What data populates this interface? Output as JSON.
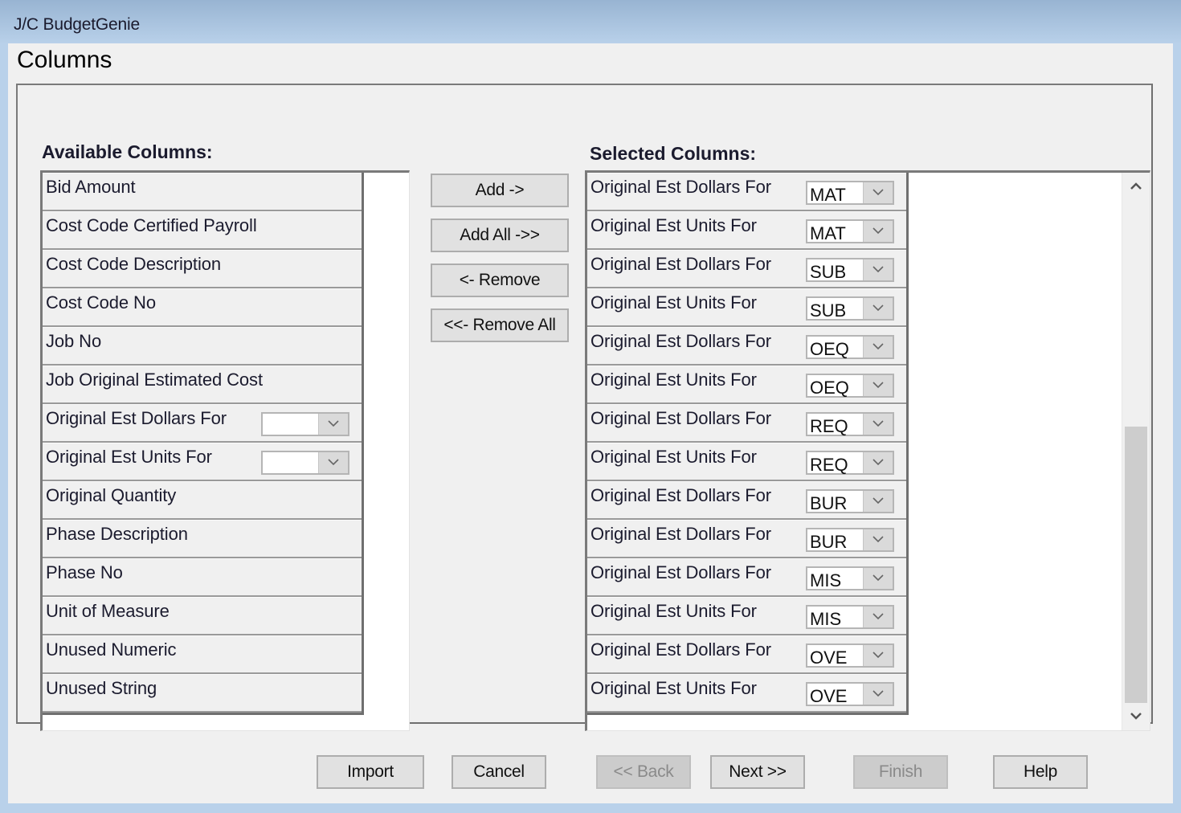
{
  "window": {
    "app_title": "J/C BudgetGenie",
    "page_title": "Columns"
  },
  "available": {
    "label": "Available Columns:",
    "items": [
      {
        "label": "Bid Amount",
        "dropdown": null
      },
      {
        "label": "Cost Code Certified Payroll",
        "dropdown": null
      },
      {
        "label": "Cost Code Description",
        "dropdown": null
      },
      {
        "label": "Cost Code No",
        "dropdown": null
      },
      {
        "label": "Job No",
        "dropdown": null
      },
      {
        "label": "Job Original Estimated Cost",
        "dropdown": null
      },
      {
        "label": "Original Est Dollars For",
        "dropdown": ""
      },
      {
        "label": "Original Est Units For",
        "dropdown": ""
      },
      {
        "label": "Original Quantity",
        "dropdown": null
      },
      {
        "label": "Phase Description",
        "dropdown": null
      },
      {
        "label": "Phase No",
        "dropdown": null
      },
      {
        "label": "Unit of Measure",
        "dropdown": null
      },
      {
        "label": "Unused Numeric",
        "dropdown": null
      },
      {
        "label": "Unused String",
        "dropdown": null
      }
    ]
  },
  "transfer_buttons": {
    "add": "Add ->",
    "add_all": "Add All ->>",
    "remove": "<- Remove",
    "remove_all": "<<- Remove All"
  },
  "selected": {
    "label": "Selected Columns:",
    "scroll_position": 0.55,
    "scroll_visible_fraction": 0.55,
    "items": [
      {
        "label": "Original Est Dollars For",
        "dropdown": "MAT"
      },
      {
        "label": "Original Est Units For",
        "dropdown": "MAT"
      },
      {
        "label": "Original Est Dollars For",
        "dropdown": "SUB"
      },
      {
        "label": "Original Est Units For",
        "dropdown": "SUB"
      },
      {
        "label": "Original Est Dollars For",
        "dropdown": "OEQ"
      },
      {
        "label": "Original Est Units For",
        "dropdown": "OEQ"
      },
      {
        "label": "Original Est Dollars For",
        "dropdown": "REQ"
      },
      {
        "label": "Original Est Units For",
        "dropdown": "REQ"
      },
      {
        "label": "Original Est Dollars For",
        "dropdown": "BUR"
      },
      {
        "label": "Original Est Dollars For",
        "dropdown": "BUR"
      },
      {
        "label": "Original Est Dollars For",
        "dropdown": "MIS"
      },
      {
        "label": "Original Est Units For",
        "dropdown": "MIS"
      },
      {
        "label": "Original Est Dollars For",
        "dropdown": "OVE"
      },
      {
        "label": "Original Est Units For",
        "dropdown": "OVE"
      }
    ]
  },
  "footer_buttons": {
    "import": "Import",
    "cancel": "Cancel",
    "back": "<< Back",
    "next": "Next >>",
    "finish": "Finish",
    "help": "Help"
  },
  "icons": {
    "dropdown": "chevron-down-icon",
    "scroll_up": "chevron-up-icon",
    "scroll_down": "chevron-down-icon"
  }
}
